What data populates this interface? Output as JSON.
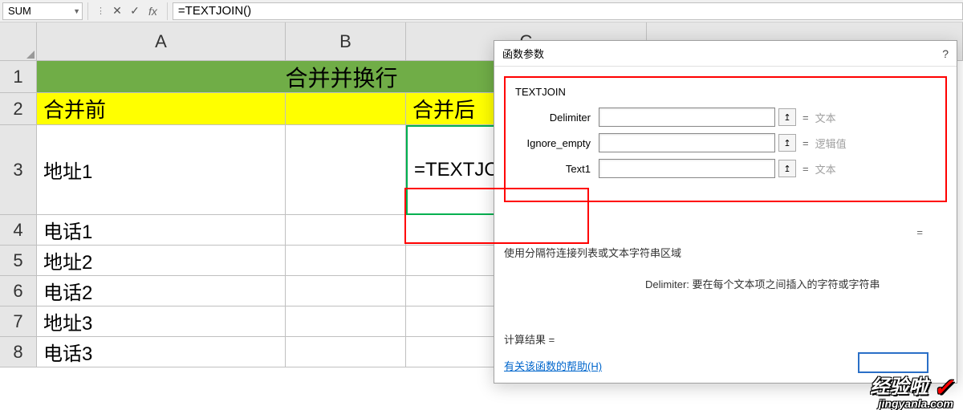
{
  "formula_bar": {
    "name_box": "SUM",
    "cancel_icon": "✕",
    "confirm_icon": "✓",
    "fx_label": "fx",
    "formula": "=TEXTJOIN()"
  },
  "columns": [
    "A",
    "B",
    "C"
  ],
  "rows": {
    "r1": {
      "num": "1",
      "merged": "合并并换行"
    },
    "r2": {
      "num": "2",
      "a": "合并前",
      "c": "合并后"
    },
    "r3": {
      "num": "3",
      "a": "地址1",
      "c": "=TEXTJOIN()"
    },
    "r4": {
      "num": "4",
      "a": "电话1"
    },
    "r5": {
      "num": "5",
      "a": "地址2"
    },
    "r6": {
      "num": "6",
      "a": "电话2"
    },
    "r7": {
      "num": "7",
      "a": "地址3"
    },
    "r8": {
      "num": "8",
      "a": "电话3"
    }
  },
  "dialog": {
    "title": "函数参数",
    "help_icon": "?",
    "fn_name": "TEXTJOIN",
    "args": [
      {
        "label": "Delimiter",
        "hint": "文本"
      },
      {
        "label": "Ignore_empty",
        "hint": "逻辑值"
      },
      {
        "label": "Text1",
        "hint": "文本"
      }
    ],
    "eq": "= ",
    "eq_big": "=",
    "desc": "使用分隔符连接列表或文本字符串区域",
    "arg_desc_label": "Delimiter:",
    "arg_desc_text": "  要在每个文本项之间插入的字符或字符串",
    "result": "计算结果 =",
    "help_link": "有关该函数的帮助(H)",
    "ref_icon": "↥"
  },
  "watermark": {
    "main": "经验啦",
    "check": "✓",
    "sub": "jingyanla.com"
  }
}
